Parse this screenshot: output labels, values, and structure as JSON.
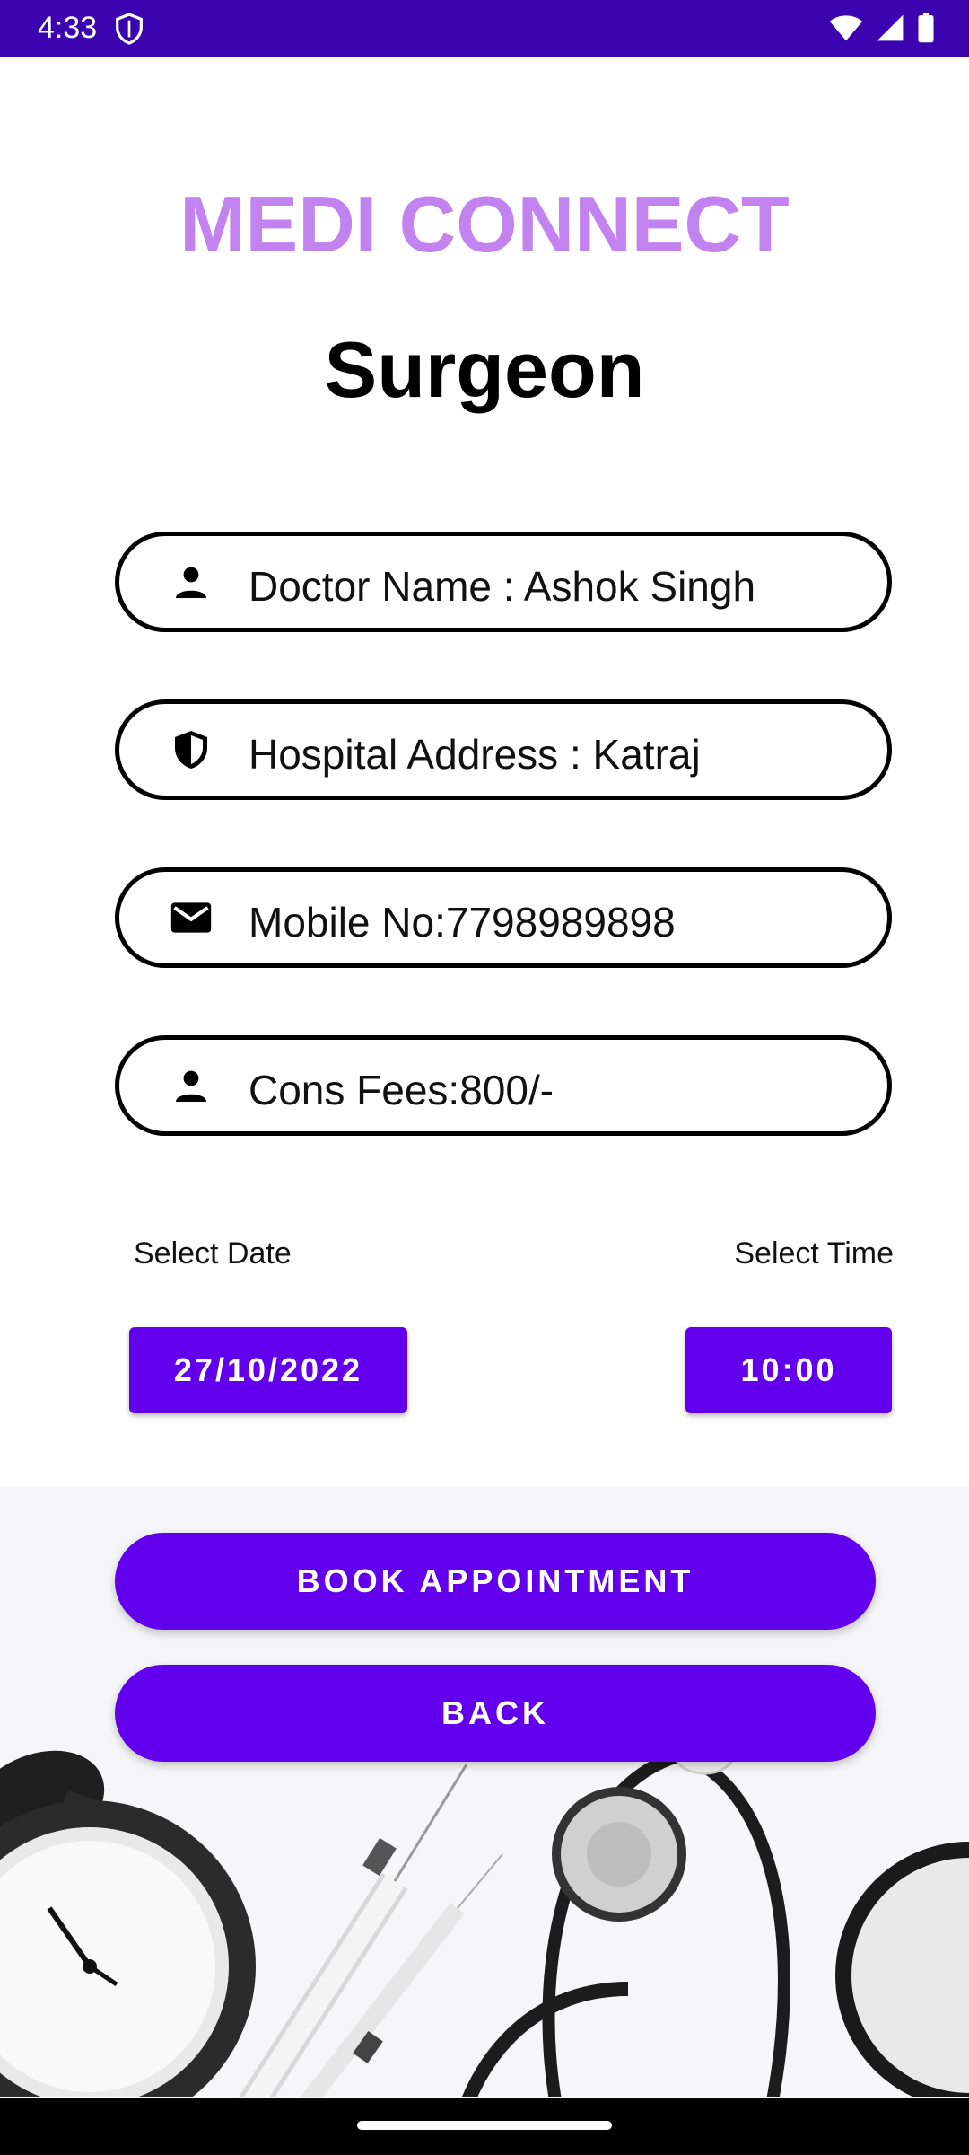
{
  "status_bar": {
    "time": "4:33",
    "icons": [
      "shield-icon",
      "wifi-icon",
      "signal-icon",
      "battery-icon"
    ]
  },
  "app_title": "MEDI CONNECT",
  "page_title": "Surgeon",
  "fields": [
    {
      "icon": "person-icon",
      "text": "Doctor Name : Ashok Singh"
    },
    {
      "icon": "shield-icon",
      "text": "Hospital Address : Katraj"
    },
    {
      "icon": "mail-icon",
      "text": "Mobile No:7798989898"
    },
    {
      "icon": "person-icon",
      "text": "Cons Fees:800/-"
    }
  ],
  "date_label": "Select Date",
  "time_label": "Select Time",
  "date_value": "27/10/2022",
  "time_value": "10:00",
  "book_label": "BOOK APPOINTMENT",
  "back_label": "BACK",
  "colors": {
    "status_bar": "#3c04b0",
    "title": "#c282f0",
    "button": "#6200ee"
  }
}
